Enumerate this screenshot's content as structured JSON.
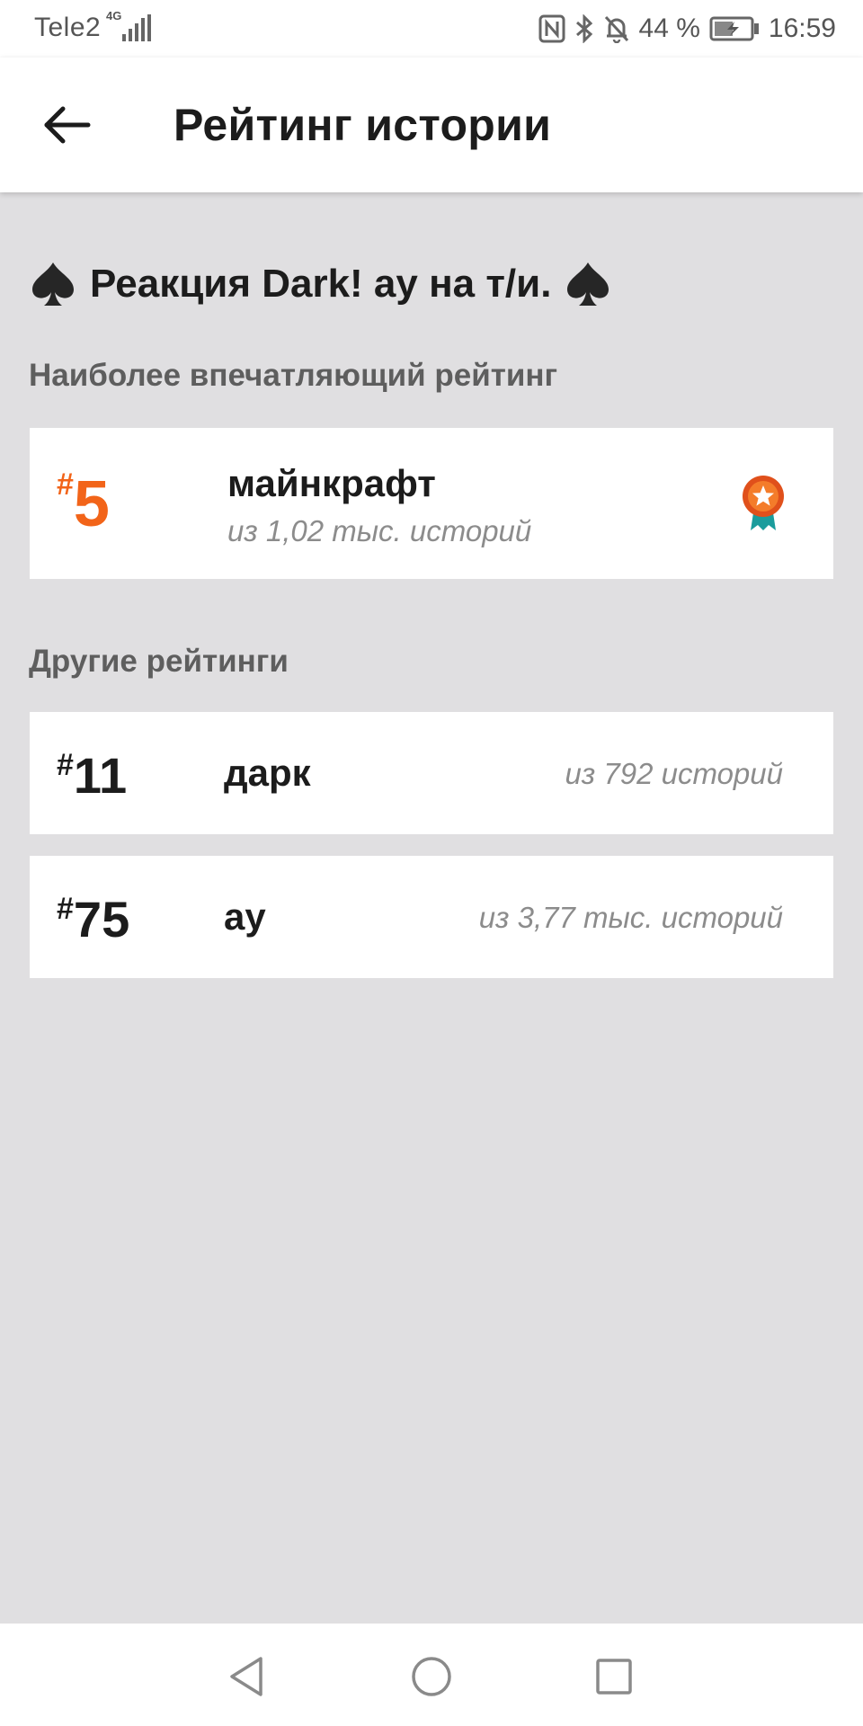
{
  "status_bar": {
    "carrier": "Tele2",
    "network_badge": "4G",
    "battery_percent": "44 %",
    "time": "16:59",
    "icons": [
      "nfc-icon",
      "bluetooth-icon",
      "bell-off-icon",
      "battery-charging-icon"
    ]
  },
  "header": {
    "back_icon": "arrow-left-icon",
    "title": "Рейтинг истории"
  },
  "story": {
    "title": "Реакция Dark! ау на т/и.",
    "decoration_icon": "spade-icon"
  },
  "top_section": {
    "label": "Наиболее впечатляющий рейтинг",
    "item": {
      "hash": "#",
      "rank": "5",
      "tag": "майнкрафт",
      "subtitle": "из 1,02 тыс. историй",
      "badge_icon": "medal-icon",
      "accent_color": "#f26419"
    }
  },
  "other_section": {
    "label": "Другие рейтинги",
    "items": [
      {
        "hash": "#",
        "rank": "11",
        "tag": "дарк",
        "subtitle": "из 792 историй"
      },
      {
        "hash": "#",
        "rank": "75",
        "tag": "ау",
        "subtitle": "из 3,77 тыс. историй"
      }
    ]
  },
  "nav_bar": {
    "icons": [
      "nav-back-icon",
      "nav-home-icon",
      "nav-recent-icon"
    ]
  }
}
